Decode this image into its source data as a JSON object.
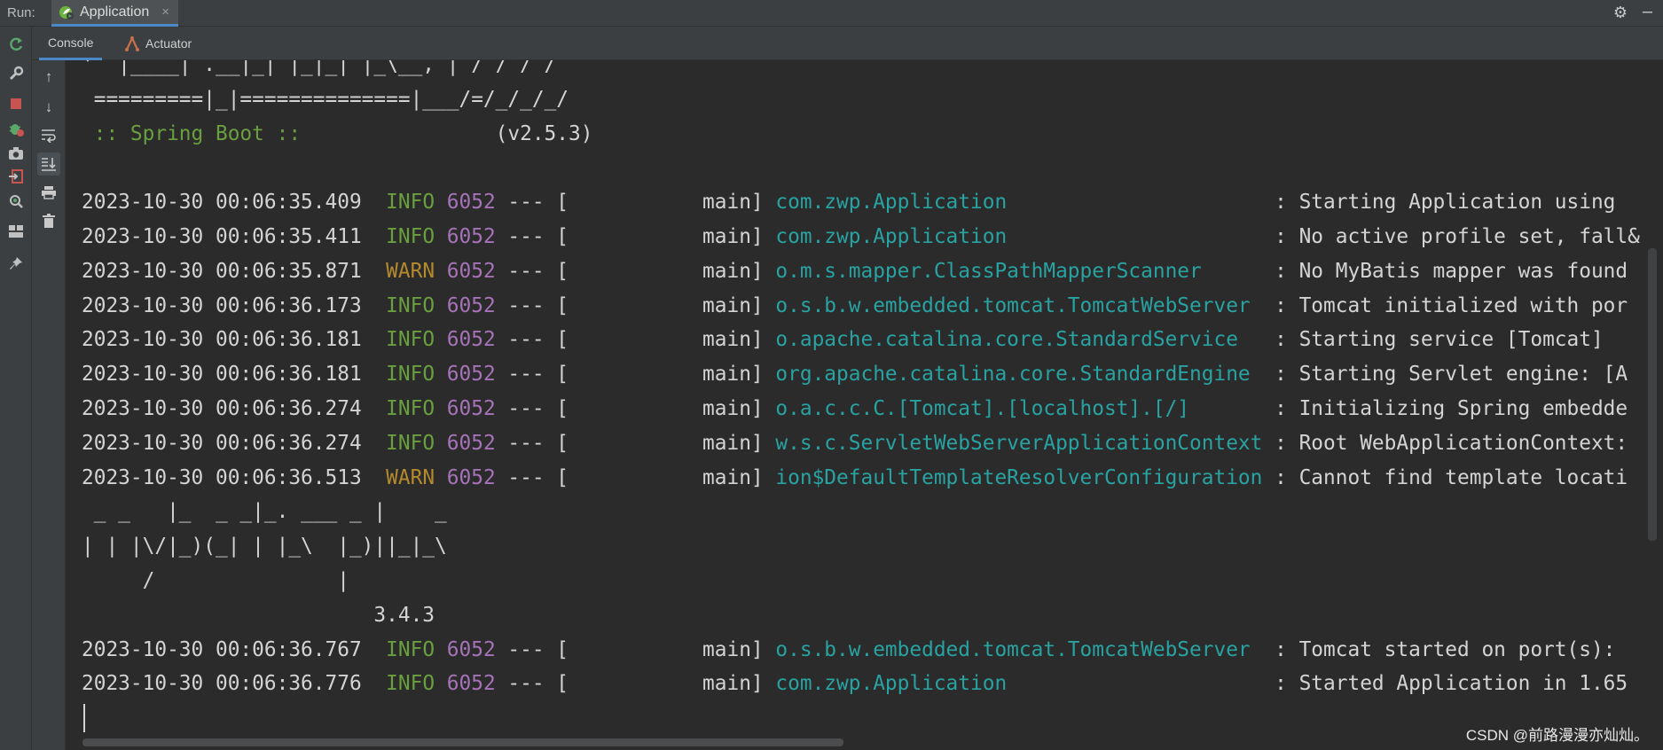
{
  "header": {
    "run_label": "Run:",
    "run_tab": "Application",
    "icons": {
      "settings": "gear-icon",
      "minimize": "minus-icon"
    }
  },
  "subtabs": [
    {
      "label": "Console",
      "active": true
    },
    {
      "label": "Actuator",
      "active": false
    }
  ],
  "left_toolbar": [
    "rerun-icon",
    "wrench-icon",
    "stop-icon",
    "debug-bug-icon",
    "camera-icon",
    "exit-icon",
    "inspect-icon",
    "layout-icon",
    "pin-icon"
  ],
  "console_toolbar": [
    "arrow-up-icon",
    "arrow-down-icon",
    "soft-wrap-icon",
    "scroll-to-end-icon",
    "print-icon",
    "trash-icon"
  ],
  "banner": {
    "line1": "'  |____| .__|_| |_|_| |_\\__, | / / / /",
    "line2": " =========|_|==============|___/=/_/_/_/",
    "spring_label": " :: Spring Boot ::",
    "version": "                (v2.5.3)"
  },
  "logs_part1": [
    {
      "ts": "2023-10-30 00:06:35.409",
      "level": "INFO",
      "pid": "6052",
      "sep": " --- [",
      "thread": "           main]",
      "logger": "com.zwp.Application                     ",
      "msg": " : Starting Application using"
    },
    {
      "ts": "2023-10-30 00:06:35.411",
      "level": "INFO",
      "pid": "6052",
      "sep": " --- [",
      "thread": "           main]",
      "logger": "com.zwp.Application                     ",
      "msg": " : No active profile set, fall&"
    },
    {
      "ts": "2023-10-30 00:06:35.871",
      "level": "WARN",
      "pid": "6052",
      "sep": " --- [",
      "thread": "           main]",
      "logger": "o.m.s.mapper.ClassPathMapperScanner     ",
      "msg": " : No MyBatis mapper was found"
    },
    {
      "ts": "2023-10-30 00:06:36.173",
      "level": "INFO",
      "pid": "6052",
      "sep": " --- [",
      "thread": "           main]",
      "logger": "o.s.b.w.embedded.tomcat.TomcatWebServer ",
      "msg": " : Tomcat initialized with por"
    },
    {
      "ts": "2023-10-30 00:06:36.181",
      "level": "INFO",
      "pid": "6052",
      "sep": " --- [",
      "thread": "           main]",
      "logger": "o.apache.catalina.core.StandardService  ",
      "msg": " : Starting service [Tomcat]"
    },
    {
      "ts": "2023-10-30 00:06:36.181",
      "level": "INFO",
      "pid": "6052",
      "sep": " --- [",
      "thread": "           main]",
      "logger": "org.apache.catalina.core.StandardEngine ",
      "msg": " : Starting Servlet engine: [A"
    },
    {
      "ts": "2023-10-30 00:06:36.274",
      "level": "INFO",
      "pid": "6052",
      "sep": " --- [",
      "thread": "           main]",
      "logger": "o.a.c.c.C.[Tomcat].[localhost].[/]      ",
      "msg": " : Initializing Spring embedde"
    },
    {
      "ts": "2023-10-30 00:06:36.274",
      "level": "INFO",
      "pid": "6052",
      "sep": " --- [",
      "thread": "           main]",
      "logger": "w.s.c.ServletWebServerApplicationContext",
      "msg": " : Root WebApplicationContext:"
    },
    {
      "ts": "2023-10-30 00:06:36.513",
      "level": "WARN",
      "pid": "6052",
      "sep": " --- [",
      "thread": "           main]",
      "logger": "ion$DefaultTemplateResolverConfiguration",
      "msg": " : Cannot find template locati"
    }
  ],
  "mybatis_banner": [
    " _ _   |_  _ _|_. ___ _ |    _",
    "| | |\\/|_)(_| | |_\\  |_)||_|_\\",
    "     /               |",
    "                        3.4.3"
  ],
  "logs_part2": [
    {
      "ts": "2023-10-30 00:06:36.767",
      "level": "INFO",
      "pid": "6052",
      "sep": " --- [",
      "thread": "           main]",
      "logger": "o.s.b.w.embedded.tomcat.TomcatWebServer ",
      "msg": " : Tomcat started on port(s):"
    },
    {
      "ts": "2023-10-30 00:06:36.776",
      "level": "INFO",
      "pid": "6052",
      "sep": " --- [",
      "thread": "           main]",
      "logger": "com.zwp.Application                     ",
      "msg": " : Started Application in 1.65"
    }
  ],
  "watermark": "CSDN @前路漫漫亦灿灿。",
  "colors": {
    "background": "#2b2b2b",
    "toolbar": "#3c3f41",
    "info": "#6a9f3f",
    "warn": "#b48a2d",
    "pid": "#a672b8",
    "logger": "#29a2a2",
    "accent": "#4a88c7"
  }
}
